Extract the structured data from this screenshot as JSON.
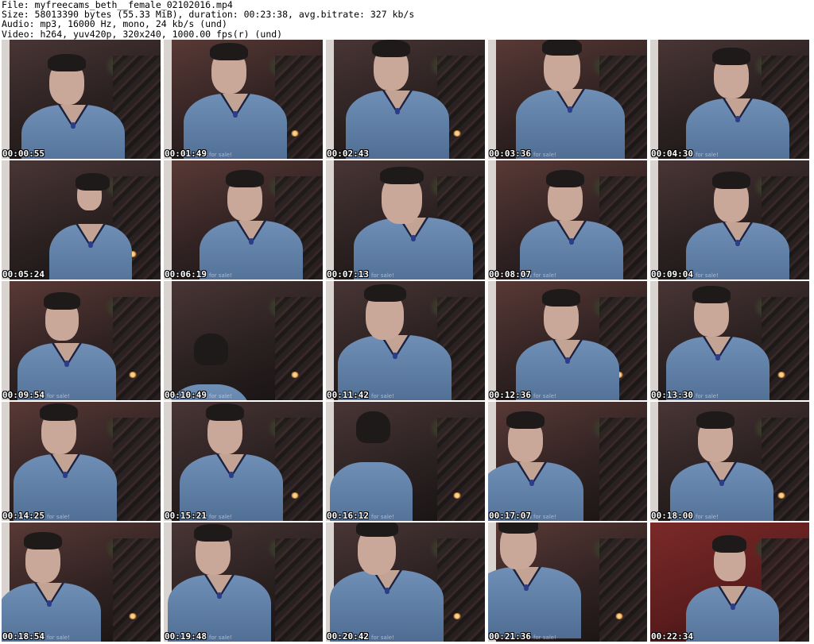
{
  "header": {
    "line1": "File: myfreecams_beth__female_02102016.mp4",
    "line2": "Size: 58013390 bytes (55.33 MiB), duration: 00:23:38, avg.bitrate: 327 kb/s",
    "line3": "Audio: mp3, 16000 Hz, mono, 24 kb/s (und)",
    "line4": "Video: h264, yuv420p, 320x240, 1000.00 fps(r) (und)"
  },
  "thumbnails": [
    {
      "timestamp": "00:00:55",
      "watermark": ""
    },
    {
      "timestamp": "00:01:49",
      "watermark": "nts for sale!"
    },
    {
      "timestamp": "00:02:43",
      "watermark": ""
    },
    {
      "timestamp": "00:03:36",
      "watermark": "nts for sale!"
    },
    {
      "timestamp": "00:04:30",
      "watermark": "nts for sale!"
    },
    {
      "timestamp": "00:05:24",
      "watermark": ""
    },
    {
      "timestamp": "00:06:19",
      "watermark": "nts for sale!"
    },
    {
      "timestamp": "00:07:13",
      "watermark": "nts for sale!"
    },
    {
      "timestamp": "00:08:07",
      "watermark": "nts for sale!"
    },
    {
      "timestamp": "00:09:04",
      "watermark": "nts for sale!"
    },
    {
      "timestamp": "00:09:54",
      "watermark": "nts for sale!"
    },
    {
      "timestamp": "00:10:49",
      "watermark": "nts for sale!"
    },
    {
      "timestamp": "00:11:42",
      "watermark": "nts for sale!"
    },
    {
      "timestamp": "00:12:36",
      "watermark": "nts for sale!"
    },
    {
      "timestamp": "00:13:30",
      "watermark": "nts for sale!"
    },
    {
      "timestamp": "00:14:25",
      "watermark": "nts for sale!"
    },
    {
      "timestamp": "00:15:21",
      "watermark": "nts for sale!"
    },
    {
      "timestamp": "00:16:12",
      "watermark": "nts for sale!"
    },
    {
      "timestamp": "00:17:07",
      "watermark": "nts for sale!"
    },
    {
      "timestamp": "00:18:00",
      "watermark": "nts for sale!"
    },
    {
      "timestamp": "00:18:54",
      "watermark": "nts for sale!"
    },
    {
      "timestamp": "00:19:48",
      "watermark": "nts for sale!"
    },
    {
      "timestamp": "00:20:42",
      "watermark": "nts for sale!"
    },
    {
      "timestamp": "00:21:36",
      "watermark": "nts for sale!"
    },
    {
      "timestamp": "00:22:34",
      "watermark": ""
    }
  ],
  "colors": {
    "wall": "#3a2a2a",
    "wall_warm": "#5a3232",
    "wall_red": "#8a2222",
    "sweater": "#6f8fb6"
  }
}
